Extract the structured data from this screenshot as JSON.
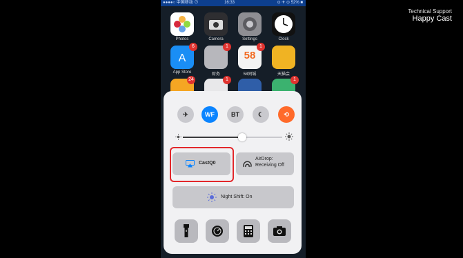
{
  "watermark": {
    "line1": "Technical Support",
    "line2": "Happy Cast"
  },
  "statusbar": {
    "left": "●●●●○ 中国移动 ⊙",
    "time": "16:33",
    "right": "⊙ ✈ ⊙ 52% ■"
  },
  "home": {
    "row1": [
      {
        "label": "Photos",
        "icon": "photos-icon"
      },
      {
        "label": "Camera",
        "icon": "camera-icon"
      },
      {
        "label": "Settings",
        "icon": "settings-icon"
      },
      {
        "label": "Clock",
        "icon": "clock-icon"
      }
    ],
    "row2": [
      {
        "label": "App Store",
        "icon": "appstore-icon",
        "badge": "6"
      },
      {
        "label": "财务",
        "icon": "folder-icon",
        "badge": "1"
      },
      {
        "label": "58同城",
        "icon": "app-58-icon",
        "badge": "1",
        "text": "58"
      },
      {
        "label": "天猫会",
        "icon": "app-tp-icon"
      }
    ],
    "row3_badges": [
      "24",
      "1",
      "1"
    ]
  },
  "control_center": {
    "toggles": [
      {
        "name": "airplane-toggle",
        "label": "✈"
      },
      {
        "name": "wifi-toggle",
        "label": "WF",
        "state": "on"
      },
      {
        "name": "bluetooth-toggle",
        "label": "BT"
      },
      {
        "name": "do-not-disturb-toggle",
        "label": "☾"
      },
      {
        "name": "rotation-lock-toggle",
        "label": "⟲",
        "state": "on"
      }
    ],
    "brightness": {
      "level": 0.6
    },
    "airplay": {
      "label": "CastQ0"
    },
    "airdrop": {
      "line1": "AirDrop:",
      "line2": "Receiving Off"
    },
    "night_shift": {
      "label": "Night Shift: On"
    },
    "bottom_buttons": [
      "flashlight-icon",
      "timer-icon",
      "calculator-icon",
      "camera-icon"
    ]
  },
  "colors": {
    "accent": "#0a84ff",
    "highlight": "#e3272b"
  }
}
